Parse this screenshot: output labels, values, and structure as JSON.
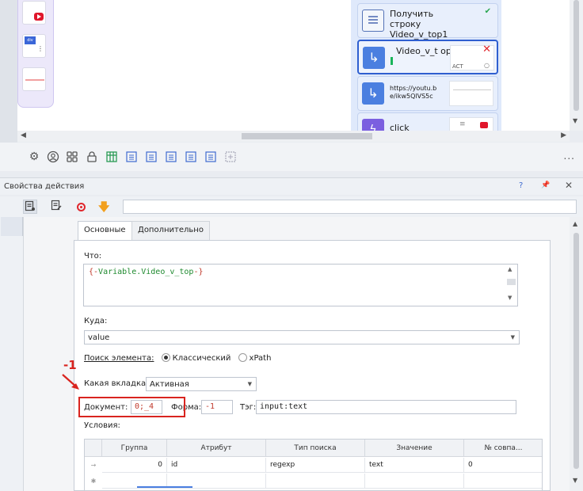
{
  "canvas": {
    "nodes": [
      {
        "label": "Получить строку Video_v_top1",
        "icon": "list-icon"
      },
      {
        "label": "Video_v_t op",
        "icon": "arrow-icon",
        "selected": true
      },
      {
        "label": "https://youtu.b e/ikw5QlVS5c",
        "icon": "arrow-icon"
      },
      {
        "label": "click",
        "icon": "lightning-icon"
      }
    ],
    "thumb_text_1": "ACT",
    "div_label": "div"
  },
  "toolbar": {
    "icons": [
      "settings-icon",
      "user-icon",
      "grid-icon",
      "lock-icon",
      "table-icon",
      "list-icon-1",
      "list-icon-2",
      "list-icon-3",
      "list-icon-4",
      "add-icon"
    ],
    "more": "..."
  },
  "props": {
    "title": "Свойства действия",
    "help": "?",
    "action_name": ""
  },
  "tabs": [
    {
      "label": "Основные",
      "active": true
    },
    {
      "label": "Дополнительно",
      "active": false
    }
  ],
  "form": {
    "what_label": "Что:",
    "what_open": "{-",
    "what_var": "Variable.Video_v_top",
    "what_close": "-}",
    "where_label": "Куда:",
    "where_value": "value",
    "search_label": "Поиск элемента:",
    "search_classic": "Классический",
    "search_xpath": "xPath",
    "tab_label": "Какая вкладка:",
    "tab_value": "Активная",
    "doc_label": "Документ:",
    "doc_value": "0;_4",
    "form_label": "Форма:",
    "form_value": "-1",
    "tag_label": "Тэг:",
    "tag_value": "input:text",
    "conditions_label": "Условия:"
  },
  "annotation": "-1",
  "table": {
    "headers": [
      "Группа",
      "Атрибут",
      "Тип поиска",
      "Значение",
      "№ совпа..."
    ],
    "rows": [
      {
        "marker": "→",
        "group": "0",
        "attribute": "id",
        "search_type": "regexp",
        "value": "text",
        "match": "0"
      },
      {
        "marker": "✱",
        "group": "",
        "attribute": "",
        "search_type": "",
        "value": "",
        "match": ""
      }
    ]
  }
}
